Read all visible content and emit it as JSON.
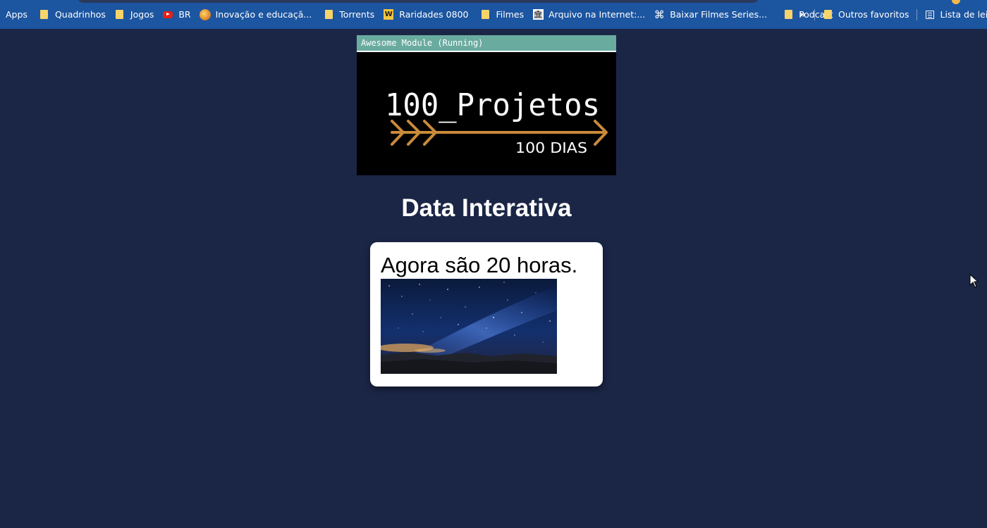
{
  "bookmarks_bar": {
    "items": [
      {
        "label": "Apps",
        "icon": "apps-icon"
      },
      {
        "label": "Quadrinhos",
        "icon": "folder-icon"
      },
      {
        "label": "Jogos",
        "icon": "folder-icon"
      },
      {
        "label": "BR",
        "icon": "youtube-icon"
      },
      {
        "label": "Inovação e educaçã...",
        "icon": "site-favicon-icon"
      },
      {
        "label": "Torrents",
        "icon": "folder-icon"
      },
      {
        "label": "Raridades 0800",
        "icon": "site-favicon-icon"
      },
      {
        "label": "Filmes",
        "icon": "folder-icon"
      },
      {
        "label": "Arquivo na Internet:...",
        "icon": "archive-icon"
      },
      {
        "label": "Baixar Filmes Series...",
        "icon": "command-icon"
      },
      {
        "label": "Podcast",
        "icon": "folder-icon"
      }
    ],
    "overflow_label": "»",
    "other_favorites_label": "Outros favoritos",
    "reading_list_label": "Lista de leitura"
  },
  "module": {
    "title": "Awesome Module (Running)",
    "logo_text": "100_Projetos",
    "logo_subtext": "100 DIAS"
  },
  "page": {
    "title": "Data Interativa",
    "time_message": "Agora são 20 horas."
  },
  "colors": {
    "background": "#1b2646",
    "bookmarks_bar": "#1c55a0",
    "module_titlebar": "#6aaba0",
    "logo_arrow": "#c98a3a",
    "card": "#ffffff"
  }
}
